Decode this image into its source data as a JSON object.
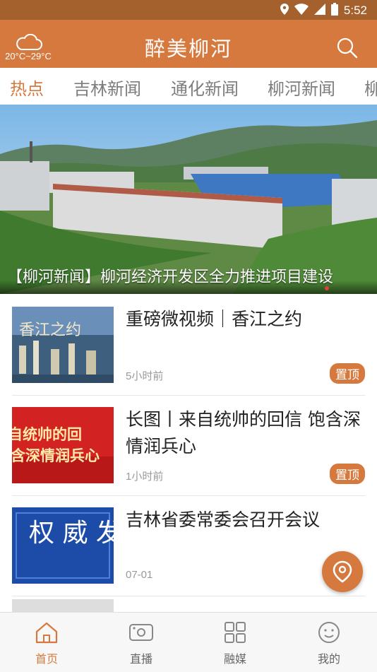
{
  "status_bar": {
    "time": "5:52"
  },
  "header": {
    "title": "醉美柳河",
    "weather": {
      "temp_range": "20°C~29°C",
      "icon": "cloud-icon"
    },
    "search_icon": "search-icon"
  },
  "tabs": [
    "热点",
    "吉林新闻",
    "通化新闻",
    "柳河新闻",
    "柳"
  ],
  "banner": {
    "caption": "【柳河新闻】柳河经济开发区全力推进项目建设"
  },
  "news": [
    {
      "title": "重磅微视频｜香江之约",
      "time": "5小时前",
      "badge": "置顶",
      "thumb_text": "香江之约"
    },
    {
      "title": "长图丨来自统帅的回信 饱含深情润兵心",
      "time": "1小时前",
      "badge": "置顶",
      "thumb_text": "自统帅的回 含深情润兵心"
    },
    {
      "title": "吉林省委常委会召开会议",
      "time": "07-01",
      "badge": "",
      "thumb_text": "权 威 发 布"
    }
  ],
  "bottom_nav": [
    {
      "label": "首页",
      "icon": "home-icon"
    },
    {
      "label": "直播",
      "icon": "video-camera-icon"
    },
    {
      "label": "融媒",
      "icon": "grid-icon"
    },
    {
      "label": "我的",
      "icon": "smiley-icon"
    }
  ],
  "colors": {
    "accent": "#d6793e",
    "status_bar": "#a4602d"
  }
}
